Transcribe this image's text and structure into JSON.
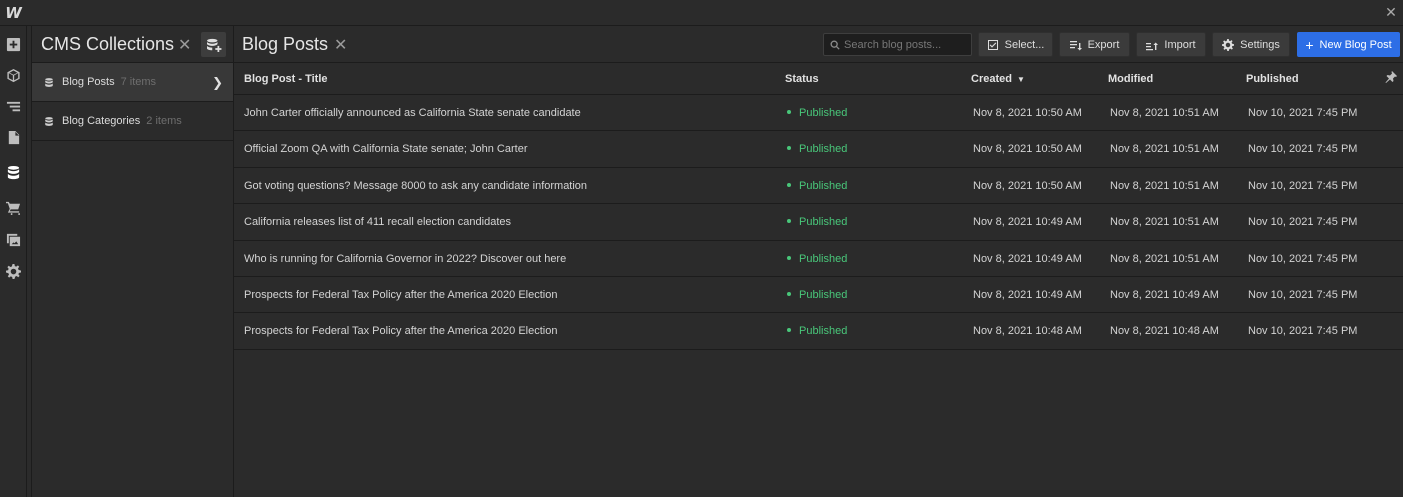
{
  "app": {
    "logo": "W",
    "close_glyph": "✕"
  },
  "rail": {
    "icons": [
      "add-panel-icon",
      "components-icon",
      "navigator-icon",
      "pages-icon",
      "cms-icon",
      "ecommerce-icon",
      "assets-icon",
      "settings-icon"
    ],
    "active": "cms-icon"
  },
  "cms_panel": {
    "title": "CMS Collections",
    "close_glyph": "✕",
    "collections": [
      {
        "name": "Blog Posts",
        "count": "7 items",
        "active": true
      },
      {
        "name": "Blog Categories",
        "count": "2 items",
        "active": false
      }
    ]
  },
  "main": {
    "title": "Blog Posts",
    "close_glyph": "✕",
    "search_placeholder": "Search blog posts...",
    "toolbar": {
      "select_label": "Select...",
      "export_label": "Export",
      "import_label": "Import",
      "settings_label": "Settings",
      "new_label": "New Blog Post"
    },
    "accent_color": "#2d6ee6",
    "status_color": "#49c77a"
  },
  "table": {
    "columns": [
      "Blog Post - Title",
      "Status",
      "Created",
      "Modified",
      "Published"
    ],
    "sorted_column": "Created",
    "rows": [
      {
        "title": "John Carter officially announced as California State senate candidate",
        "status": "Published",
        "created": "Nov 8, 2021 10:50 AM",
        "modified": "Nov 8, 2021 10:51 AM",
        "published": "Nov 10, 2021 7:45 PM"
      },
      {
        "title": "Official Zoom QA with California State senate; John Carter",
        "status": "Published",
        "created": "Nov 8, 2021 10:50 AM",
        "modified": "Nov 8, 2021 10:51 AM",
        "published": "Nov 10, 2021 7:45 PM"
      },
      {
        "title": "Got voting questions? Message 8000 to ask any candidate information",
        "status": "Published",
        "created": "Nov 8, 2021 10:50 AM",
        "modified": "Nov 8, 2021 10:51 AM",
        "published": "Nov 10, 2021 7:45 PM"
      },
      {
        "title": "California releases list of 411 recall election candidates",
        "status": "Published",
        "created": "Nov 8, 2021 10:49 AM",
        "modified": "Nov 8, 2021 10:51 AM",
        "published": "Nov 10, 2021 7:45 PM"
      },
      {
        "title": "Who is running for California Governor in 2022? Discover out here",
        "status": "Published",
        "created": "Nov 8, 2021 10:49 AM",
        "modified": "Nov 8, 2021 10:51 AM",
        "published": "Nov 10, 2021 7:45 PM"
      },
      {
        "title": "Prospects for Federal Tax Policy after the America 2020 Election",
        "status": "Published",
        "created": "Nov 8, 2021 10:49 AM",
        "modified": "Nov 8, 2021 10:49 AM",
        "published": "Nov 10, 2021 7:45 PM"
      },
      {
        "title": "Prospects for Federal Tax Policy after the America 2020 Election",
        "status": "Published",
        "created": "Nov 8, 2021 10:48 AM",
        "modified": "Nov 8, 2021 10:48 AM",
        "published": "Nov 10, 2021 7:45 PM"
      }
    ]
  }
}
